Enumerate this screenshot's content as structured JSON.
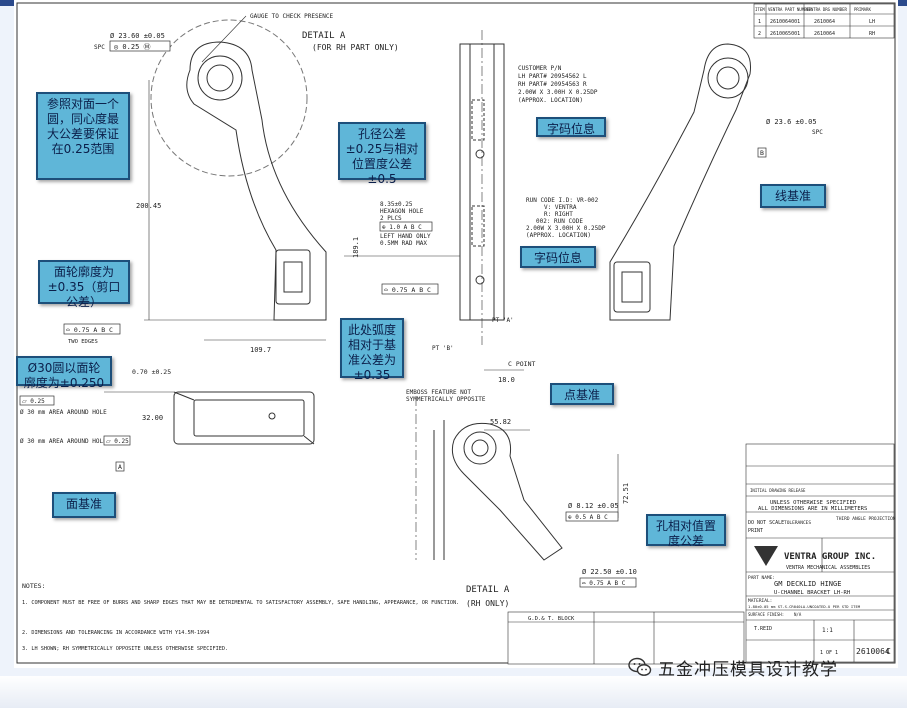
{
  "drawing": {
    "top_notes": {
      "gauge_note": "GAUGE TO CHECK PRESENCE",
      "detail_a_title": "DETAIL A",
      "detail_a_sub": "(FOR RH PART ONLY)",
      "hole_dim_top": "Ø 23.60 ±0.05",
      "hole_fcf_top": "◎ 0.25 Ⓜ",
      "spc": "SPC",
      "dim_200": "200.45",
      "dim_189": "189.1",
      "dim_109": "109.7",
      "two_edges": "TWO EDGES",
      "profile_fcf_left": "⌓ 0.75 A B C",
      "customer_pn": "CUSTOMER P/N",
      "lh_part": "LH PART# 20954562 L",
      "rh_part": "RH PART# 20954563 R",
      "size_box": "2.00W X 3.00H X 0.25DP",
      "approx_loc": "(APPROX. LOCATION)",
      "hex_hole_1": "8.35±0.25",
      "hex_hole_2": "HEXAGON HOLE",
      "hex_hole_3": "2 PLCS",
      "hex_fcf": "⊕ 1.0 A B C",
      "hex_hole_4": "LEFT HAND ONLY",
      "hex_hole_5": "0.5MM RAD MAX",
      "run_code_1": "RUN CODE I.D: VR-002",
      "run_code_2": "V: VENTRA",
      "run_code_3": "R: RIGHT",
      "run_code_4": "002: RUN CODE",
      "run_code_5": "2.00W X 3.00H X 0.25DP",
      "run_code_6": "(APPROX. LOCATION)",
      "profile_fcf_mid": "⌓ 0.75 A B C",
      "pt_b": "PT 'B'",
      "pt_a": "PT 'A'",
      "point_c": "C  POINT",
      "dim_18": "18.0",
      "right_hole_dim": "Ø 23.6 ±0.05",
      "spc_right": "SPC",
      "datum_b": "B",
      "pos_070": "0.70 ±0.25",
      "flat_fcf": "⏥ 0.25",
      "area_around_hole_1": "Ø 30 mm AREA AROUND HOLE",
      "dim_32": "32.00",
      "area_around_hole_2": "Ø 30 mm AREA AROUND HOLE",
      "flat_fcf_2": "⏥ 0.25",
      "datum_a": "A",
      "emboss_note_1": "EMBOSS FEATURE NOT",
      "emboss_note_2": "SYMMETRICALLY OPPOSITE",
      "dim_55": "55.82",
      "dim_72": "72.51",
      "hole_812": "Ø 8.12 ±0.05",
      "pos_fcf_812": "⊕ 0.5 A B C",
      "hole_2250": "Ø 22.50 ±0.10",
      "profile_fcf_bottom": "⌓ 0.75 A B C",
      "detail_a_bottom": "DETAIL A",
      "rh_only": "(RH ONLY)",
      "notes_title": "NOTES:",
      "note_1": "1. COMPONENT MUST BE FREE OF BURRS AND SHARP EDGES THAT MAY BE DETRIMENTAL TO SATISFACTORY ASSEMBLY, SAFE HANDLING, APPEARANCE, OR FUNCTION.",
      "note_2": "2. DIMENSIONS AND TOLERANCING IN ACCORDANCE WITH Y14.5M-1994",
      "note_3": "3. LH SHOWN; RH SYMMETRICALLY OPPOSITE UNLESS OTHERWISE SPECIFIED."
    },
    "part_table": {
      "headers": [
        "ITEM",
        "VENTRA PART NUMBER",
        "VENTRA DRG NUMBER",
        "PRIMARK"
      ],
      "rows": [
        [
          "1",
          "2610064001",
          "2610064",
          "LH"
        ],
        [
          "2",
          "2610065001",
          "2610064",
          "RH"
        ]
      ]
    },
    "title_block": {
      "tolerance_note_1": "UNLESS OTHERWISE SPECIFIED",
      "tolerance_note_2": "ALL DIMENSIONS ARE IN MILLIMETERS",
      "do_not_scale": "DO NOT SCALE",
      "print": "PRINT",
      "tolerances": "TOLERANCES",
      "third_angle": "THIRD ANGLE PROJECTION",
      "company": "VENTRA GROUP INC.",
      "division": "VENTRA MECHANICAL ASSEMBLIES",
      "part_name_label": "PART NAME:",
      "part_name_1": "GM DECKLID HINGE",
      "part_name_2": "U-CHANNEL BRACKET LH-RH",
      "material_label": "MATERIAL:",
      "material": "1.80±0.05 mm ST-S-CR040LA-UNCOATED-U PER STD ITEM",
      "surface_label": "SURFACE FINISH:",
      "surface": "N/A",
      "drawn_by": "T.REID",
      "scale": "1:1",
      "sheet": "1 OF 1",
      "drawing_number": "2610064",
      "revision": "C",
      "revision_desc": "INITIAL DRAWING RELEASE",
      "gd_block": "G.D.& T. BLOCK"
    }
  },
  "annotations": [
    {
      "id": "concentric",
      "text": "参照对面一个圆，同心度最大公差要保证在0.25范围"
    },
    {
      "id": "hole-tol",
      "text": "孔径公差±0.25与相对位置度公差±0.5"
    },
    {
      "id": "char-pos-1",
      "text": "字码位息"
    },
    {
      "id": "line-datum",
      "text": "线基准"
    },
    {
      "id": "profile",
      "text": "面轮廓度为±0.35（剪口公差）"
    },
    {
      "id": "char-pos-2",
      "text": "字码位息"
    },
    {
      "id": "arc-tol",
      "text": "此处弧度相对于基准公差为±0.35"
    },
    {
      "id": "flatness",
      "text": "Ø30圆以面轮廓度为±0.250"
    },
    {
      "id": "point-datum",
      "text": "点基准"
    },
    {
      "id": "surface-datum",
      "text": "面基准"
    },
    {
      "id": "hole-pos",
      "text": "孔相对值置度公差"
    }
  ],
  "watermark": {
    "text": "五金冲压模具设计教学",
    "icon": "wechat-icon"
  }
}
